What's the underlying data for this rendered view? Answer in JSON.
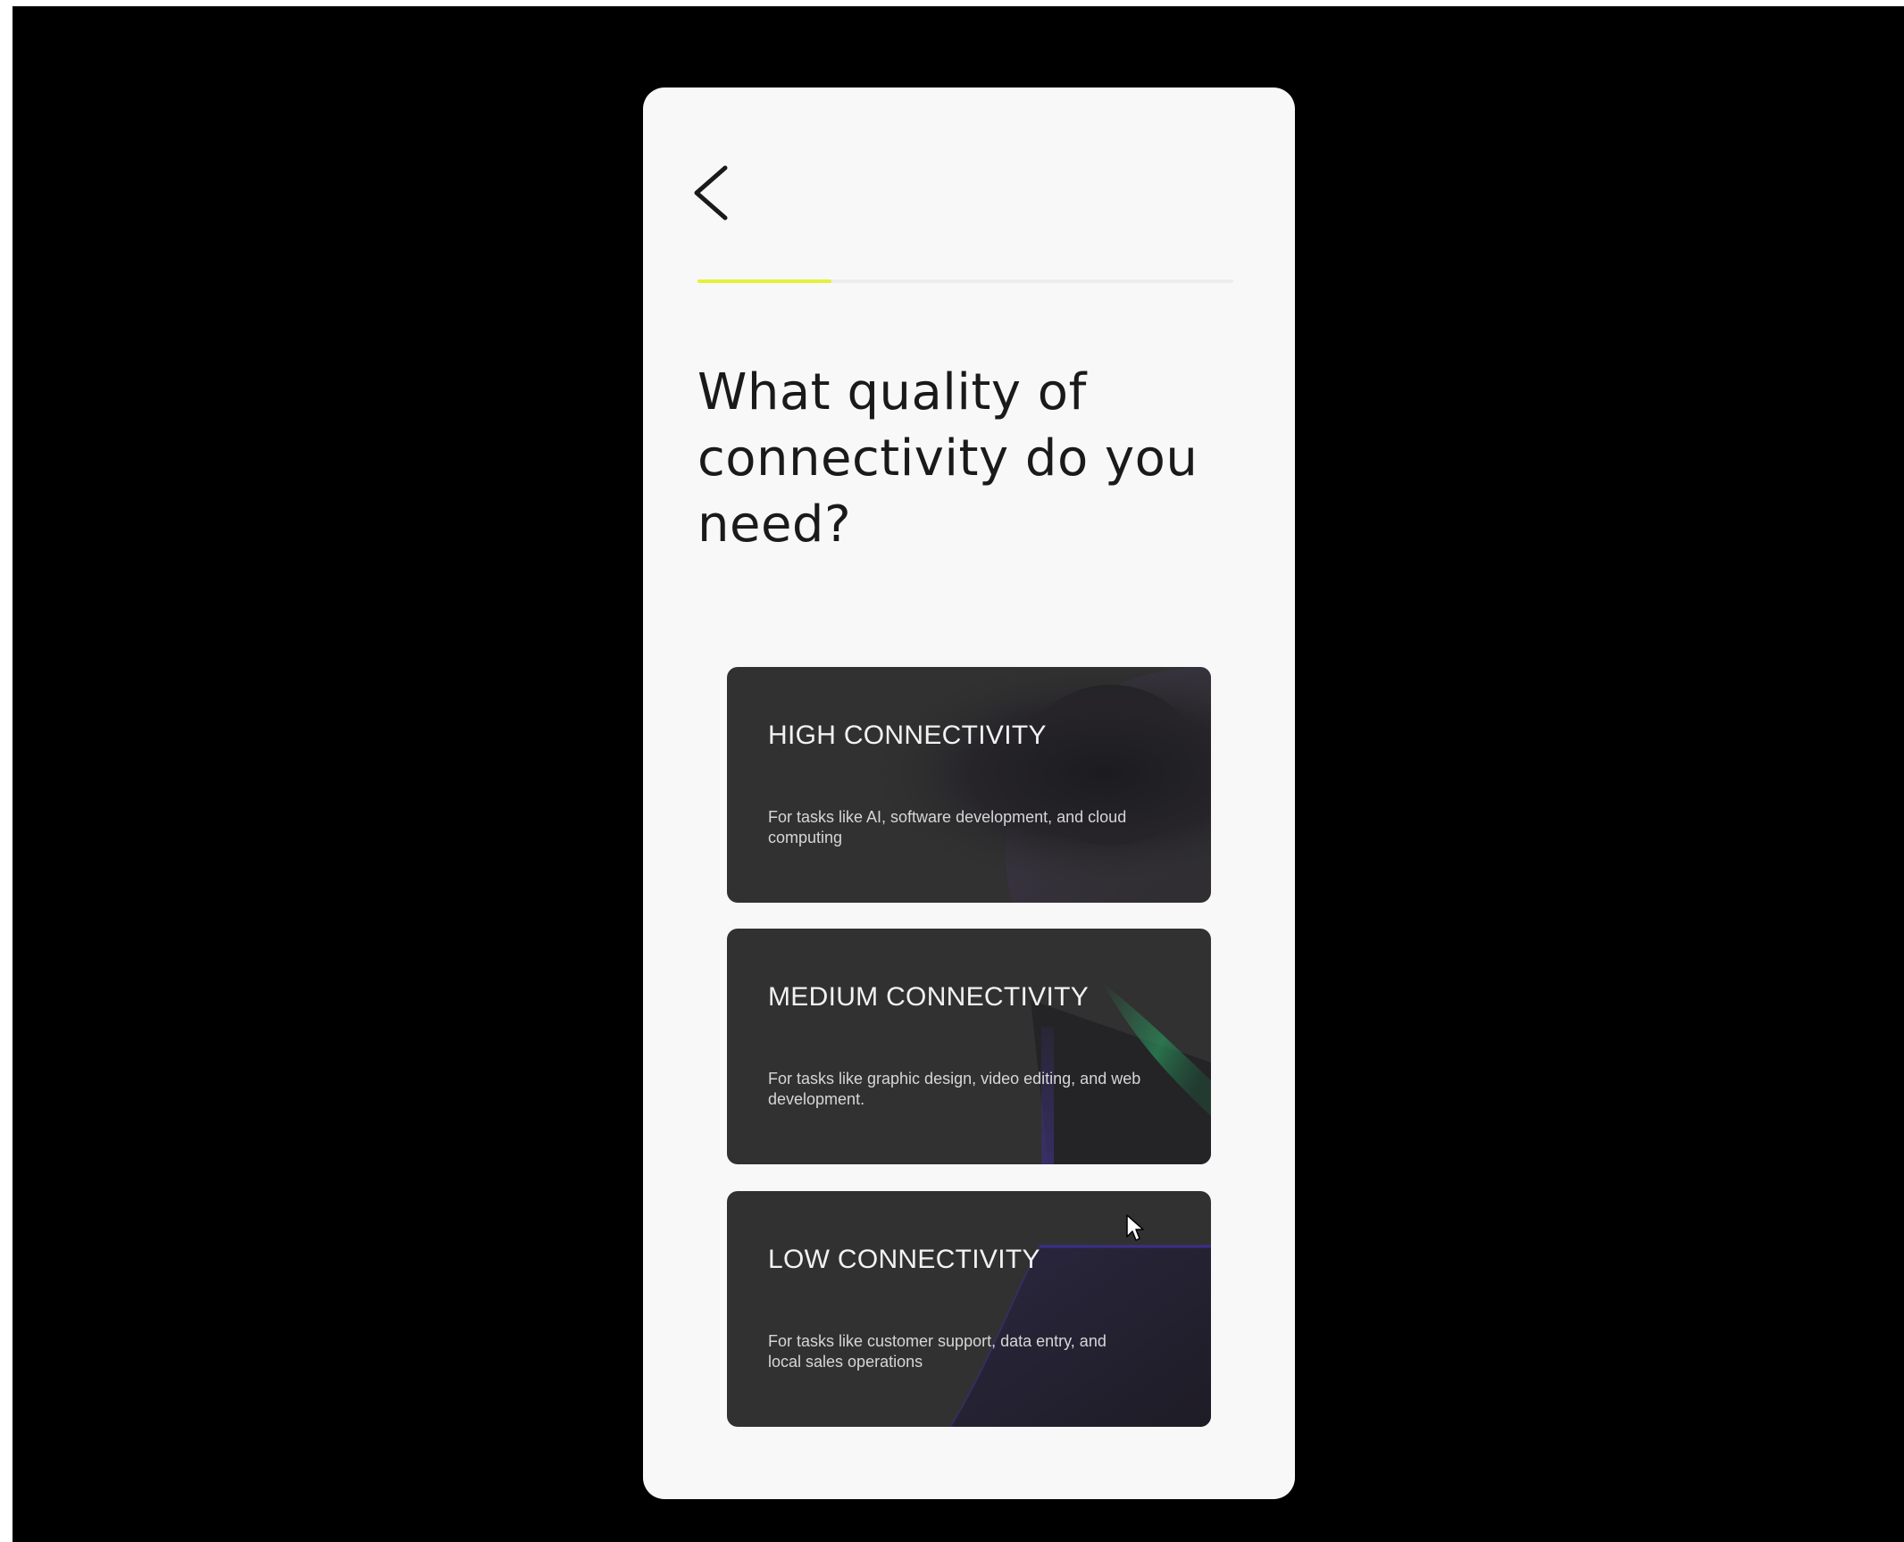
{
  "nav": {
    "back_icon": "chevron-left-icon"
  },
  "progress": {
    "fraction": 0.25,
    "fill_color": "#e4f13a",
    "track_color": "#ececec"
  },
  "question": {
    "title": "What quality of connectivity do you need?"
  },
  "options": [
    {
      "title": "HIGH CONNECTIVITY",
      "description": "For tasks like AI, software development, and cloud computing"
    },
    {
      "title": "MEDIUM CONNECTIVITY",
      "description": "For tasks like graphic design, video editing, and web development."
    },
    {
      "title": "LOW CONNECTIVITY",
      "description": "For tasks like customer support, data entry, and local sales operations"
    }
  ],
  "colors": {
    "page_background": "#000000",
    "screen_background": "#f8f8f8",
    "card_background": "#313131",
    "accent_green": "#2c8a5a",
    "accent_purple": "#3a2f6e"
  }
}
